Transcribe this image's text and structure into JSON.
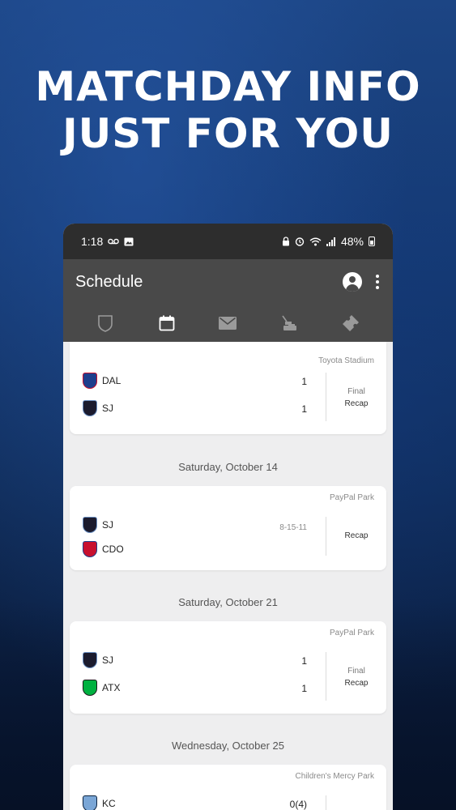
{
  "headline": {
    "line1": "MATCHDAY INFO",
    "line2": "JUST FOR YOU"
  },
  "status_bar": {
    "time": "1:18",
    "battery": "48%"
  },
  "appbar": {
    "title": "Schedule"
  },
  "colors": {
    "appbar": "#494949",
    "statusbar": "#2d2d2d",
    "background_blue": "#153a74",
    "dal_crest": "#1e3e8c",
    "sj_crest": "#1b1b2e",
    "cdo_crest": "#c8102e",
    "atx_crest": "#00b140",
    "kc_crest": "#7aa6d6"
  },
  "tabs": [
    {
      "name": "club",
      "icon": "shield-icon",
      "active": false
    },
    {
      "name": "schedule",
      "icon": "calendar-icon",
      "active": true
    },
    {
      "name": "inbox",
      "icon": "mail-icon",
      "active": false
    },
    {
      "name": "concessions",
      "icon": "food-icon",
      "active": false
    },
    {
      "name": "tickets",
      "icon": "ticket-icon",
      "active": false
    }
  ],
  "matches": [
    {
      "venue": "Toyota Stadium",
      "home": {
        "abbr": "DAL",
        "score": "1"
      },
      "away": {
        "abbr": "SJ",
        "score": "1"
      },
      "status": "Final",
      "action": "Recap"
    },
    {
      "date": "Saturday, October 14",
      "venue": "PayPal Park",
      "home": {
        "abbr": "SJ"
      },
      "away": {
        "abbr": "CDO"
      },
      "series": "8-15-11",
      "action": "Recap"
    },
    {
      "date": "Saturday, October 21",
      "venue": "PayPal Park",
      "home": {
        "abbr": "SJ",
        "score": "1"
      },
      "away": {
        "abbr": "ATX",
        "score": "1"
      },
      "status": "Final",
      "action": "Recap"
    },
    {
      "date": "Wednesday, October 25",
      "venue": "Children's Mercy Park",
      "home": {
        "abbr": "KC",
        "score": "0(4)"
      }
    }
  ]
}
